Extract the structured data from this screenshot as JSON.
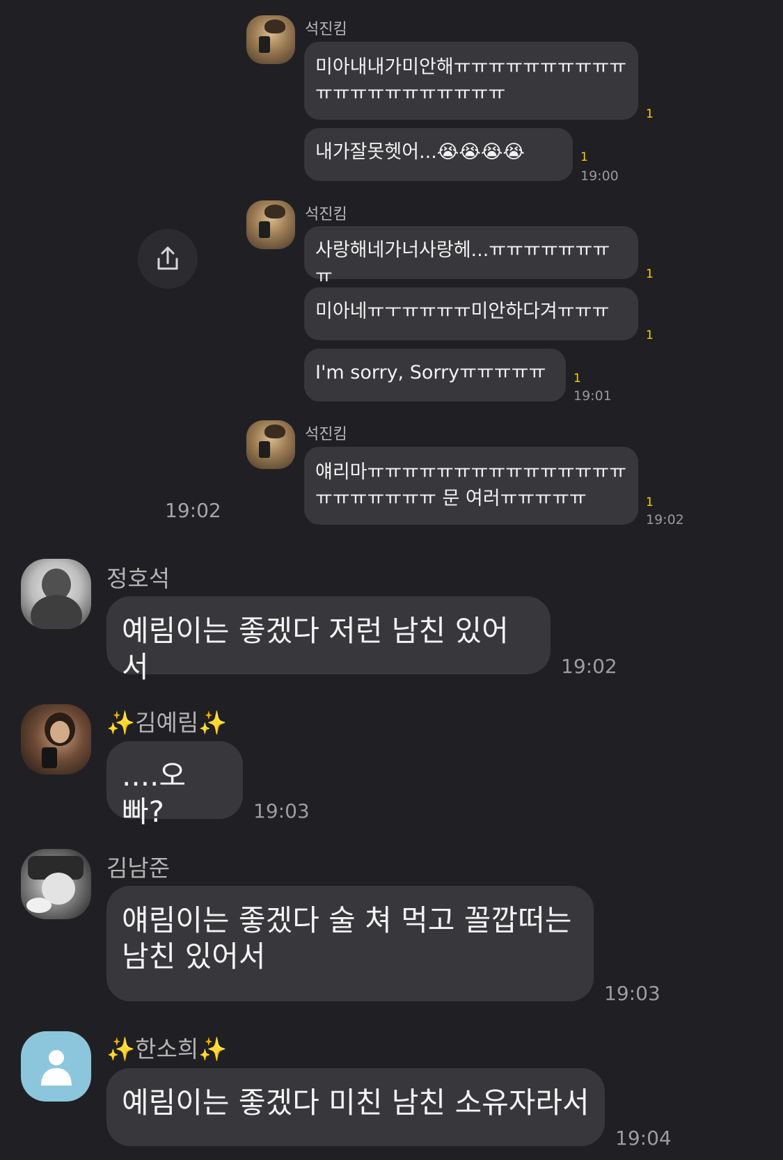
{
  "quote": {
    "groups": [
      {
        "sender": "석진킴",
        "messages": [
          {
            "text": "미아내내가미안해ㅠㅠㅠㅠㅠㅠㅠㅠㅠㅠㅠㅠㅠㅠㅠㅠㅠㅠㅠㅠㅠ",
            "unread": "1",
            "time": ""
          },
          {
            "text": "내가잘못헷어...😭😭😭😭",
            "unread": "1",
            "time": "19:00"
          }
        ]
      },
      {
        "sender": "석진킴",
        "messages": [
          {
            "text": "사랑해네가너사랑헤...ㅠㅠㅠㅠㅠㅠㅠㅠ",
            "unread": "1",
            "time": ""
          },
          {
            "text": "미아네ㅠㅜㅠㅠㅠㅠ미안하다겨ㅠㅠㅠ",
            "unread": "1",
            "time": ""
          },
          {
            "text": "I'm sorry, Sorryㅠㅠㅠㅠㅠ",
            "unread": "1",
            "time": "19:01"
          }
        ]
      },
      {
        "sender": "석진킴",
        "messages": [
          {
            "text": "얘리마ㅠㅠㅠㅠㅠㅠㅠㅠㅠㅠㅠㅠㅠㅠㅠㅠㅠㅠㅠㅠㅠㅠ 문 여러ㅠㅠㅠㅠㅠ",
            "unread": "1",
            "time": "19:02"
          }
        ]
      }
    ],
    "time": "19:02",
    "share_icon": "share-icon"
  },
  "chat": [
    {
      "sender": "정호석",
      "sparkle": false,
      "text": "예림이는 좋겠다 저런 남친 있어서",
      "time": "19:02"
    },
    {
      "sender": "김예림",
      "sparkle": true,
      "text": "....오빠?",
      "time": "19:03"
    },
    {
      "sender": "김남준",
      "sparkle": false,
      "text": "얘림이는 좋겠다 술 쳐 먹고 꼴깝떠는\n남친 있어서",
      "time": "19:03"
    },
    {
      "sender": "한소희",
      "sparkle": true,
      "text": "예림이는 좋겠다 미친 남친 소유자라서",
      "time": "19:04"
    }
  ],
  "sparkle_glyph": "✨",
  "colors": {
    "background": "#202024",
    "bubble": "#38383c",
    "unread": "#f5d10b",
    "sparkle": "#f7d548"
  }
}
